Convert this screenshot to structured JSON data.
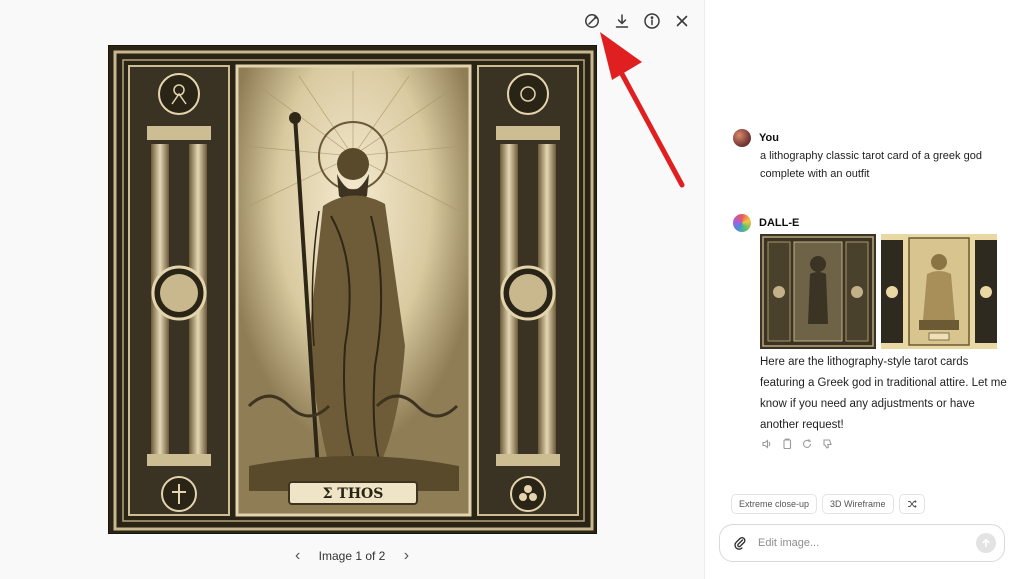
{
  "viewer": {
    "toolbar": {
      "icons": [
        "edit-brush-icon",
        "download-icon",
        "info-icon",
        "close-icon"
      ]
    },
    "card_caption": "Σ THOS",
    "pager": {
      "label": "Image 1 of 2",
      "prev_icon": "chevron-left-icon",
      "next_icon": "chevron-right-icon"
    },
    "annotation_arrow_color": "#e02020"
  },
  "chat": {
    "user_message": {
      "name": "You",
      "text": "a lithography classic tarot card of a greek god complete with an outfit"
    },
    "assistant_message": {
      "name": "DALL-E",
      "reply": "Here are the lithography-style tarot cards featuring a Greek god in traditional attire. Let me know if you need any adjustments or have another request!",
      "thumbnail_count": 2,
      "action_icons": [
        "speaker-icon",
        "copy-icon",
        "regenerate-icon",
        "thumbs-down-icon"
      ]
    },
    "suggestions": [
      "Extreme close-up",
      "3D Wireframe"
    ],
    "shuffle_icon": "shuffle-icon",
    "composer": {
      "placeholder": "Edit image...",
      "attach_icon": "paperclip-icon",
      "send_icon": "send-arrow-icon"
    }
  }
}
